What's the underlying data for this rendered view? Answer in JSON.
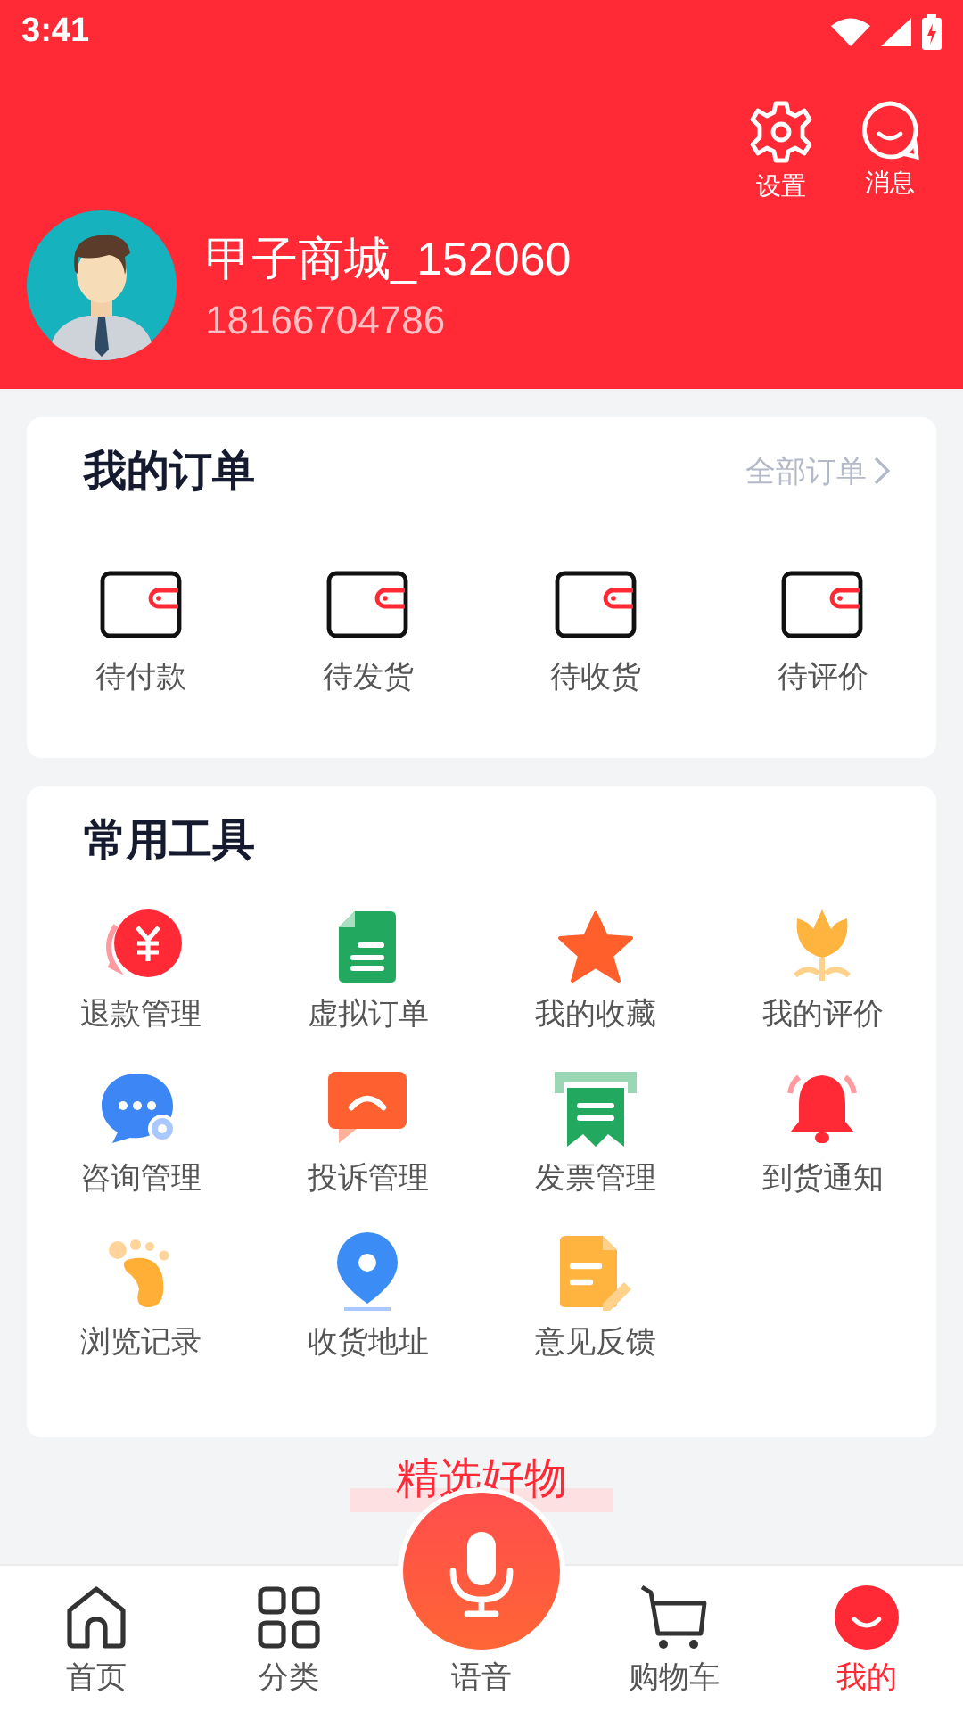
{
  "status_bar": {
    "time": "3:41"
  },
  "header": {
    "actions": [
      {
        "label": "设置"
      },
      {
        "label": "消息"
      }
    ],
    "user": {
      "name": "甲子商城_152060",
      "phone": "18166704786"
    }
  },
  "orders": {
    "title": "我的订单",
    "all_link": "全部订单",
    "items": [
      {
        "label": "待付款"
      },
      {
        "label": "待发货"
      },
      {
        "label": "待收货"
      },
      {
        "label": "待评价"
      }
    ]
  },
  "tools": {
    "title": "常用工具",
    "items": [
      {
        "label": "退款管理"
      },
      {
        "label": "虚拟订单"
      },
      {
        "label": "我的收藏"
      },
      {
        "label": "我的评价"
      },
      {
        "label": "咨询管理"
      },
      {
        "label": "投诉管理"
      },
      {
        "label": "发票管理"
      },
      {
        "label": "到货通知"
      },
      {
        "label": "浏览记录"
      },
      {
        "label": "收货地址"
      },
      {
        "label": "意见反馈"
      }
    ]
  },
  "section_title": "精选好物",
  "tab_bar": [
    {
      "label": "首页",
      "selected": false
    },
    {
      "label": "分类",
      "selected": false
    },
    {
      "label": "语音",
      "selected": false
    },
    {
      "label": "购物车",
      "selected": false
    },
    {
      "label": "我的",
      "selected": true
    }
  ]
}
